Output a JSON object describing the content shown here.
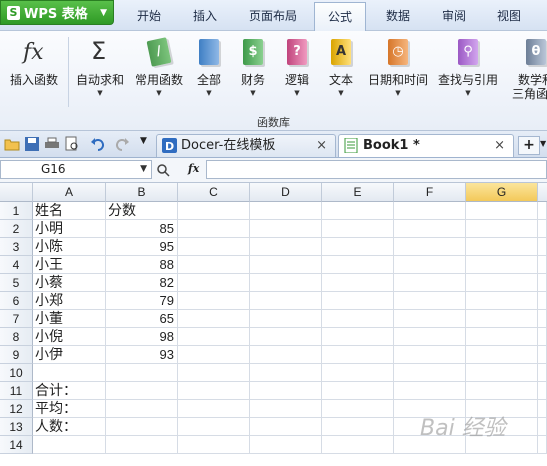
{
  "app": {
    "button_label": "WPS 表格",
    "logo_letter": "S"
  },
  "menu_tabs": [
    {
      "label": "开始"
    },
    {
      "label": "插入"
    },
    {
      "label": "页面布局"
    },
    {
      "label": "公式",
      "active": true
    },
    {
      "label": "数据"
    },
    {
      "label": "审阅"
    },
    {
      "label": "视图"
    }
  ],
  "ribbon": {
    "group_label": "函数库",
    "buttons": [
      {
        "label": "插入函数",
        "icon": "fx-icon",
        "dropdown": false
      },
      {
        "label": "自动求和",
        "icon": "sigma-icon",
        "dropdown": true
      },
      {
        "label": "常用函数",
        "icon": "book-icon",
        "dropdown": true
      },
      {
        "label": "全部",
        "icon": "book-icon",
        "dropdown": true
      },
      {
        "label": "财务",
        "icon": "dollar-book-icon",
        "dropdown": true
      },
      {
        "label": "逻辑",
        "icon": "question-book-icon",
        "dropdown": true
      },
      {
        "label": "文本",
        "icon": "text-book-icon",
        "dropdown": true
      },
      {
        "label": "日期和时间",
        "icon": "clock-book-icon",
        "dropdown": true
      },
      {
        "label": "查找与引用",
        "icon": "search-book-icon",
        "dropdown": true
      },
      {
        "label": "数学和",
        "label2": "三角函数",
        "icon": "theta-book-icon",
        "dropdown": false
      }
    ]
  },
  "doc_tabs": [
    {
      "label": "Docer-在线模板",
      "close": "×"
    },
    {
      "label": "Book1 *",
      "close": "×",
      "active": true
    }
  ],
  "formula_bar": {
    "name_box": "G16",
    "fx_symbol": "fx",
    "formula": ""
  },
  "columns": [
    "A",
    "B",
    "C",
    "D",
    "E",
    "F",
    "G"
  ],
  "selected_column": "G",
  "rows": [
    {
      "n": "1",
      "a": "姓名",
      "b": "分数"
    },
    {
      "n": "2",
      "a": "小明",
      "b": "85"
    },
    {
      "n": "3",
      "a": "小陈",
      "b": "95"
    },
    {
      "n": "4",
      "a": "小王",
      "b": "88"
    },
    {
      "n": "5",
      "a": "小蔡",
      "b": "82"
    },
    {
      "n": "6",
      "a": "小郑",
      "b": "79"
    },
    {
      "n": "7",
      "a": "小董",
      "b": "65"
    },
    {
      "n": "8",
      "a": "小倪",
      "b": "98"
    },
    {
      "n": "9",
      "a": "小伊",
      "b": "93"
    },
    {
      "n": "10",
      "a": "",
      "b": ""
    },
    {
      "n": "11",
      "a": "合计：",
      "b": ""
    },
    {
      "n": "12",
      "a": "平均：",
      "b": ""
    },
    {
      "n": "13",
      "a": "人数：",
      "b": ""
    },
    {
      "n": "14",
      "a": "",
      "b": ""
    }
  ],
  "watermark": "Bai 经验"
}
